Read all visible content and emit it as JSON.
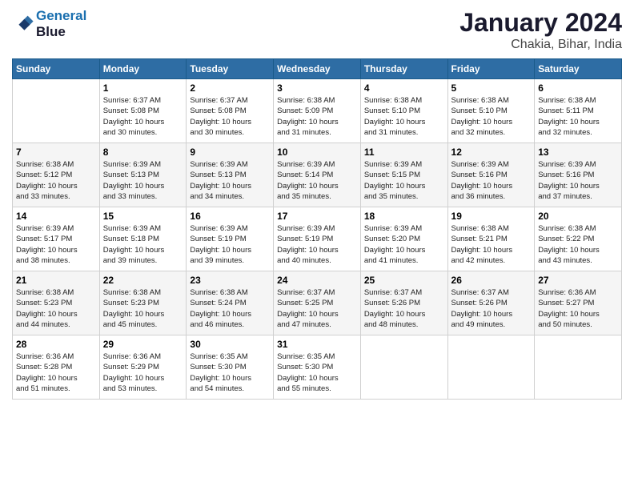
{
  "header": {
    "logo_line1": "General",
    "logo_line2": "Blue",
    "main_title": "January 2024",
    "subtitle": "Chakia, Bihar, India"
  },
  "days_header": [
    "Sunday",
    "Monday",
    "Tuesday",
    "Wednesday",
    "Thursday",
    "Friday",
    "Saturday"
  ],
  "weeks": [
    [
      {
        "day": "",
        "info": ""
      },
      {
        "day": "1",
        "info": "Sunrise: 6:37 AM\nSunset: 5:08 PM\nDaylight: 10 hours\nand 30 minutes."
      },
      {
        "day": "2",
        "info": "Sunrise: 6:37 AM\nSunset: 5:08 PM\nDaylight: 10 hours\nand 30 minutes."
      },
      {
        "day": "3",
        "info": "Sunrise: 6:38 AM\nSunset: 5:09 PM\nDaylight: 10 hours\nand 31 minutes."
      },
      {
        "day": "4",
        "info": "Sunrise: 6:38 AM\nSunset: 5:10 PM\nDaylight: 10 hours\nand 31 minutes."
      },
      {
        "day": "5",
        "info": "Sunrise: 6:38 AM\nSunset: 5:10 PM\nDaylight: 10 hours\nand 32 minutes."
      },
      {
        "day": "6",
        "info": "Sunrise: 6:38 AM\nSunset: 5:11 PM\nDaylight: 10 hours\nand 32 minutes."
      }
    ],
    [
      {
        "day": "7",
        "info": "Sunrise: 6:38 AM\nSunset: 5:12 PM\nDaylight: 10 hours\nand 33 minutes."
      },
      {
        "day": "8",
        "info": "Sunrise: 6:39 AM\nSunset: 5:13 PM\nDaylight: 10 hours\nand 33 minutes."
      },
      {
        "day": "9",
        "info": "Sunrise: 6:39 AM\nSunset: 5:13 PM\nDaylight: 10 hours\nand 34 minutes."
      },
      {
        "day": "10",
        "info": "Sunrise: 6:39 AM\nSunset: 5:14 PM\nDaylight: 10 hours\nand 35 minutes."
      },
      {
        "day": "11",
        "info": "Sunrise: 6:39 AM\nSunset: 5:15 PM\nDaylight: 10 hours\nand 35 minutes."
      },
      {
        "day": "12",
        "info": "Sunrise: 6:39 AM\nSunset: 5:16 PM\nDaylight: 10 hours\nand 36 minutes."
      },
      {
        "day": "13",
        "info": "Sunrise: 6:39 AM\nSunset: 5:16 PM\nDaylight: 10 hours\nand 37 minutes."
      }
    ],
    [
      {
        "day": "14",
        "info": "Sunrise: 6:39 AM\nSunset: 5:17 PM\nDaylight: 10 hours\nand 38 minutes."
      },
      {
        "day": "15",
        "info": "Sunrise: 6:39 AM\nSunset: 5:18 PM\nDaylight: 10 hours\nand 39 minutes."
      },
      {
        "day": "16",
        "info": "Sunrise: 6:39 AM\nSunset: 5:19 PM\nDaylight: 10 hours\nand 39 minutes."
      },
      {
        "day": "17",
        "info": "Sunrise: 6:39 AM\nSunset: 5:19 PM\nDaylight: 10 hours\nand 40 minutes."
      },
      {
        "day": "18",
        "info": "Sunrise: 6:39 AM\nSunset: 5:20 PM\nDaylight: 10 hours\nand 41 minutes."
      },
      {
        "day": "19",
        "info": "Sunrise: 6:38 AM\nSunset: 5:21 PM\nDaylight: 10 hours\nand 42 minutes."
      },
      {
        "day": "20",
        "info": "Sunrise: 6:38 AM\nSunset: 5:22 PM\nDaylight: 10 hours\nand 43 minutes."
      }
    ],
    [
      {
        "day": "21",
        "info": "Sunrise: 6:38 AM\nSunset: 5:23 PM\nDaylight: 10 hours\nand 44 minutes."
      },
      {
        "day": "22",
        "info": "Sunrise: 6:38 AM\nSunset: 5:23 PM\nDaylight: 10 hours\nand 45 minutes."
      },
      {
        "day": "23",
        "info": "Sunrise: 6:38 AM\nSunset: 5:24 PM\nDaylight: 10 hours\nand 46 minutes."
      },
      {
        "day": "24",
        "info": "Sunrise: 6:37 AM\nSunset: 5:25 PM\nDaylight: 10 hours\nand 47 minutes."
      },
      {
        "day": "25",
        "info": "Sunrise: 6:37 AM\nSunset: 5:26 PM\nDaylight: 10 hours\nand 48 minutes."
      },
      {
        "day": "26",
        "info": "Sunrise: 6:37 AM\nSunset: 5:26 PM\nDaylight: 10 hours\nand 49 minutes."
      },
      {
        "day": "27",
        "info": "Sunrise: 6:36 AM\nSunset: 5:27 PM\nDaylight: 10 hours\nand 50 minutes."
      }
    ],
    [
      {
        "day": "28",
        "info": "Sunrise: 6:36 AM\nSunset: 5:28 PM\nDaylight: 10 hours\nand 51 minutes."
      },
      {
        "day": "29",
        "info": "Sunrise: 6:36 AM\nSunset: 5:29 PM\nDaylight: 10 hours\nand 53 minutes."
      },
      {
        "day": "30",
        "info": "Sunrise: 6:35 AM\nSunset: 5:30 PM\nDaylight: 10 hours\nand 54 minutes."
      },
      {
        "day": "31",
        "info": "Sunrise: 6:35 AM\nSunset: 5:30 PM\nDaylight: 10 hours\nand 55 minutes."
      },
      {
        "day": "",
        "info": ""
      },
      {
        "day": "",
        "info": ""
      },
      {
        "day": "",
        "info": ""
      }
    ]
  ]
}
